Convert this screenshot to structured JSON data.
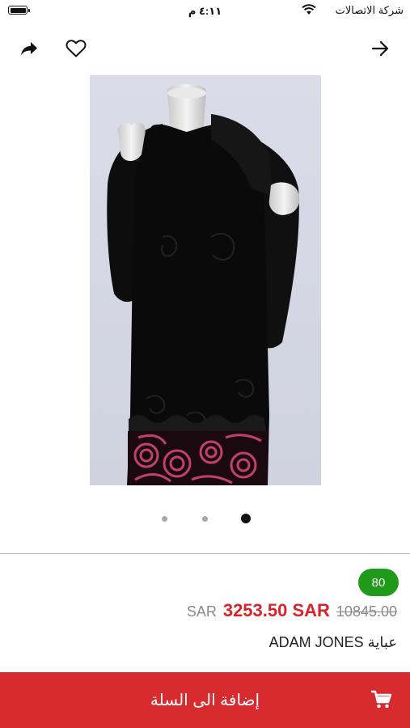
{
  "status_bar": {
    "carrier": "شركة الاتصالات",
    "time": "٤:١١ م"
  },
  "nav": {
    "back_icon": "arrow-right-icon",
    "favorite_icon": "heart-outline-icon",
    "share_icon": "share-forward-icon"
  },
  "gallery": {
    "image_count": 3,
    "active_index": 2
  },
  "product": {
    "badge": "80",
    "currency": "SAR",
    "current_price": "3253.50 SAR",
    "old_price": "10845.00",
    "name": "ADAM JONES عباية"
  },
  "cart": {
    "label": "إضافة الى السلة",
    "icon": "shopping-cart-icon"
  },
  "colors": {
    "price_red": "#d8232a",
    "badge_green": "#1f9a1b",
    "cart_bar": "#d72b2f"
  }
}
